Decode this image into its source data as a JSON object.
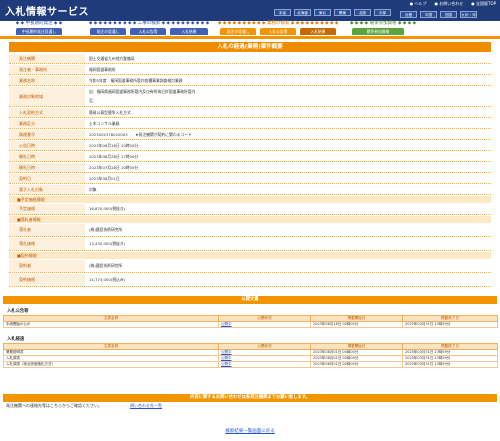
{
  "header": {
    "logo": "入札情報サービス",
    "links": [
      "● ヘルプ",
      "● お問い合わせ",
      "● 全国版TOP"
    ],
    "regions_row1": [
      "本省",
      "北海道",
      "東北",
      "関東",
      "北陸",
      "中部"
    ],
    "regions_row2": [
      "近畿",
      "中国",
      "四国",
      "九州・沖縄"
    ]
  },
  "nav": {
    "g1": {
      "title": "◆ ◆ 中長期的発注 ◆ ◆",
      "tabs": [
        "中長期的発注見通し"
      ]
    },
    "g2": {
      "title": "◆ ◆ ◆ ◆ ◆ ◆ ◆ ◆ ◆ ◆ 工事の検索 ◆ ◆ ◆ ◆ ◆ ◆ ◆ ◆ ◆ ◆",
      "tabs": [
        "発注の見通し",
        "入札公告等",
        "入札結果"
      ]
    },
    "g3": {
      "title": "◆ ◆ ◆ ◆ ◆ ◆ ◆ ◆ ◆ ◆ 業務の検索 ◆ ◆ ◆ ◆ ◆ ◆ ◆ ◆ ◆ ◆",
      "tabs": [
        "発注の見通し",
        "入札公告等",
        "入札結果"
      ]
    },
    "g4": {
      "title": "◆ ◆ ◆ ◆ 競争参加資格 ◆ ◆ ◆ ◆",
      "tabs": [
        "競争参加資格"
      ]
    }
  },
  "page": {
    "title": "入札の経過(業務)案件概要"
  },
  "fields": [
    {
      "label": "発注機関",
      "value": "国土交通省九州地方整備局"
    },
    {
      "label": "発注者・事務所",
      "value": "福岡国道事務所"
    },
    {
      "label": "業務名称",
      "value": "令和5年度　福岡国道事務所管内各種事業調査検討業務"
    },
    {
      "label": "業務対象地域",
      "value": "自：福岡県福岡国道事務所管内及び有明海沿岸国道事務所管内",
      "value2": "至："
    },
    {
      "label": "入札契約方式",
      "value": "簡易公募型競争入札方式"
    },
    {
      "label": "業務区分",
      "value": "土木コンサル業務"
    },
    {
      "label": "調達番号",
      "value": "2023002378020003　　★発注機関が契約に関わるコード"
    },
    {
      "label": "公告日時",
      "value": "2023年06月16日 10時00分"
    },
    {
      "label": "開札日時",
      "value": "2023年06月28日 17時00分"
    },
    {
      "label": "開札日時",
      "value": "2023年07月28日 10時00分"
    },
    {
      "label": "契約日",
      "value": "2023年08月01日"
    },
    {
      "label": "電子入札対象",
      "value": "対象"
    }
  ],
  "sections": {
    "plan": "■予定価格情報",
    "winner": "■落札者情報",
    "contract": "■契約情報"
  },
  "plan": [
    {
      "label": "予定価格",
      "value": "16,870,000(税抜き)"
    }
  ],
  "winner": [
    {
      "label": "落札者",
      "value": "(株)建設技術研究所"
    },
    {
      "label": "落札価格",
      "value": "13,430,000(税抜き)"
    }
  ],
  "contract": [
    {
      "label": "契約者",
      "value": "(株)建設技術研究所"
    },
    {
      "label": "契約価格",
      "value": "14,773,000(税込み)"
    }
  ],
  "docs": {
    "bar": "公開文書",
    "koukoku_label": "入札公告等",
    "headers": [
      "文書名称",
      "公開状況",
      "掲載開始日",
      "掲載終了日"
    ],
    "koukoku": [
      [
        "手続開始の公示",
        "公開中",
        "2023年06月16日 00時00分",
        "2025年03月31日 23時59分"
      ]
    ],
    "kekka_label": "入札経過",
    "kekka": [
      [
        "業務説明書",
        "公開中",
        "2023年08月01日 00時00分",
        "2025年03月31日 23時59分"
      ],
      [
        "入札調書",
        "公開中",
        "2023年08月01日 00時00分",
        "2025年03月31日 23時59分"
      ],
      [
        "入札調書（総合評価落札方式）",
        "公開中",
        "2023年08月01日 00時00分",
        "2025年03月31日 23時59分"
      ]
    ]
  },
  "contact": {
    "bar": "内容に関するお問い合わせは各発注機関までお願い致します。",
    "text": "発注機関への連絡先等はこちらからご確認ください。",
    "link": "問い合わせ先一覧"
  },
  "back": "検索結果一覧画面に戻る"
}
